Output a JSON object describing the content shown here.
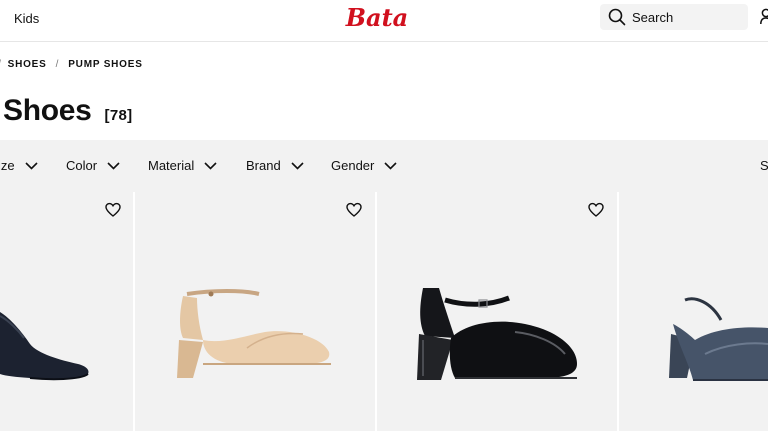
{
  "header": {
    "nav_kids": "Kids",
    "logo_text": "Bata",
    "search_label": "Search"
  },
  "breadcrumb": {
    "items": [
      "SHOES",
      "PUMP SHOES"
    ]
  },
  "title": {
    "text": "Shoes",
    "count": "[78]"
  },
  "filters": {
    "items": [
      "ize",
      "Color",
      "Material",
      "Brand",
      "Gender"
    ],
    "sort_partial": "S"
  },
  "colors": {
    "brand_red": "#d1101e",
    "card_bg": "#f2f2f2"
  },
  "icons": {
    "search": "search-icon",
    "user": "user-icon",
    "favorite": "heart-icon",
    "dropdown": "chevron-down-icon"
  }
}
